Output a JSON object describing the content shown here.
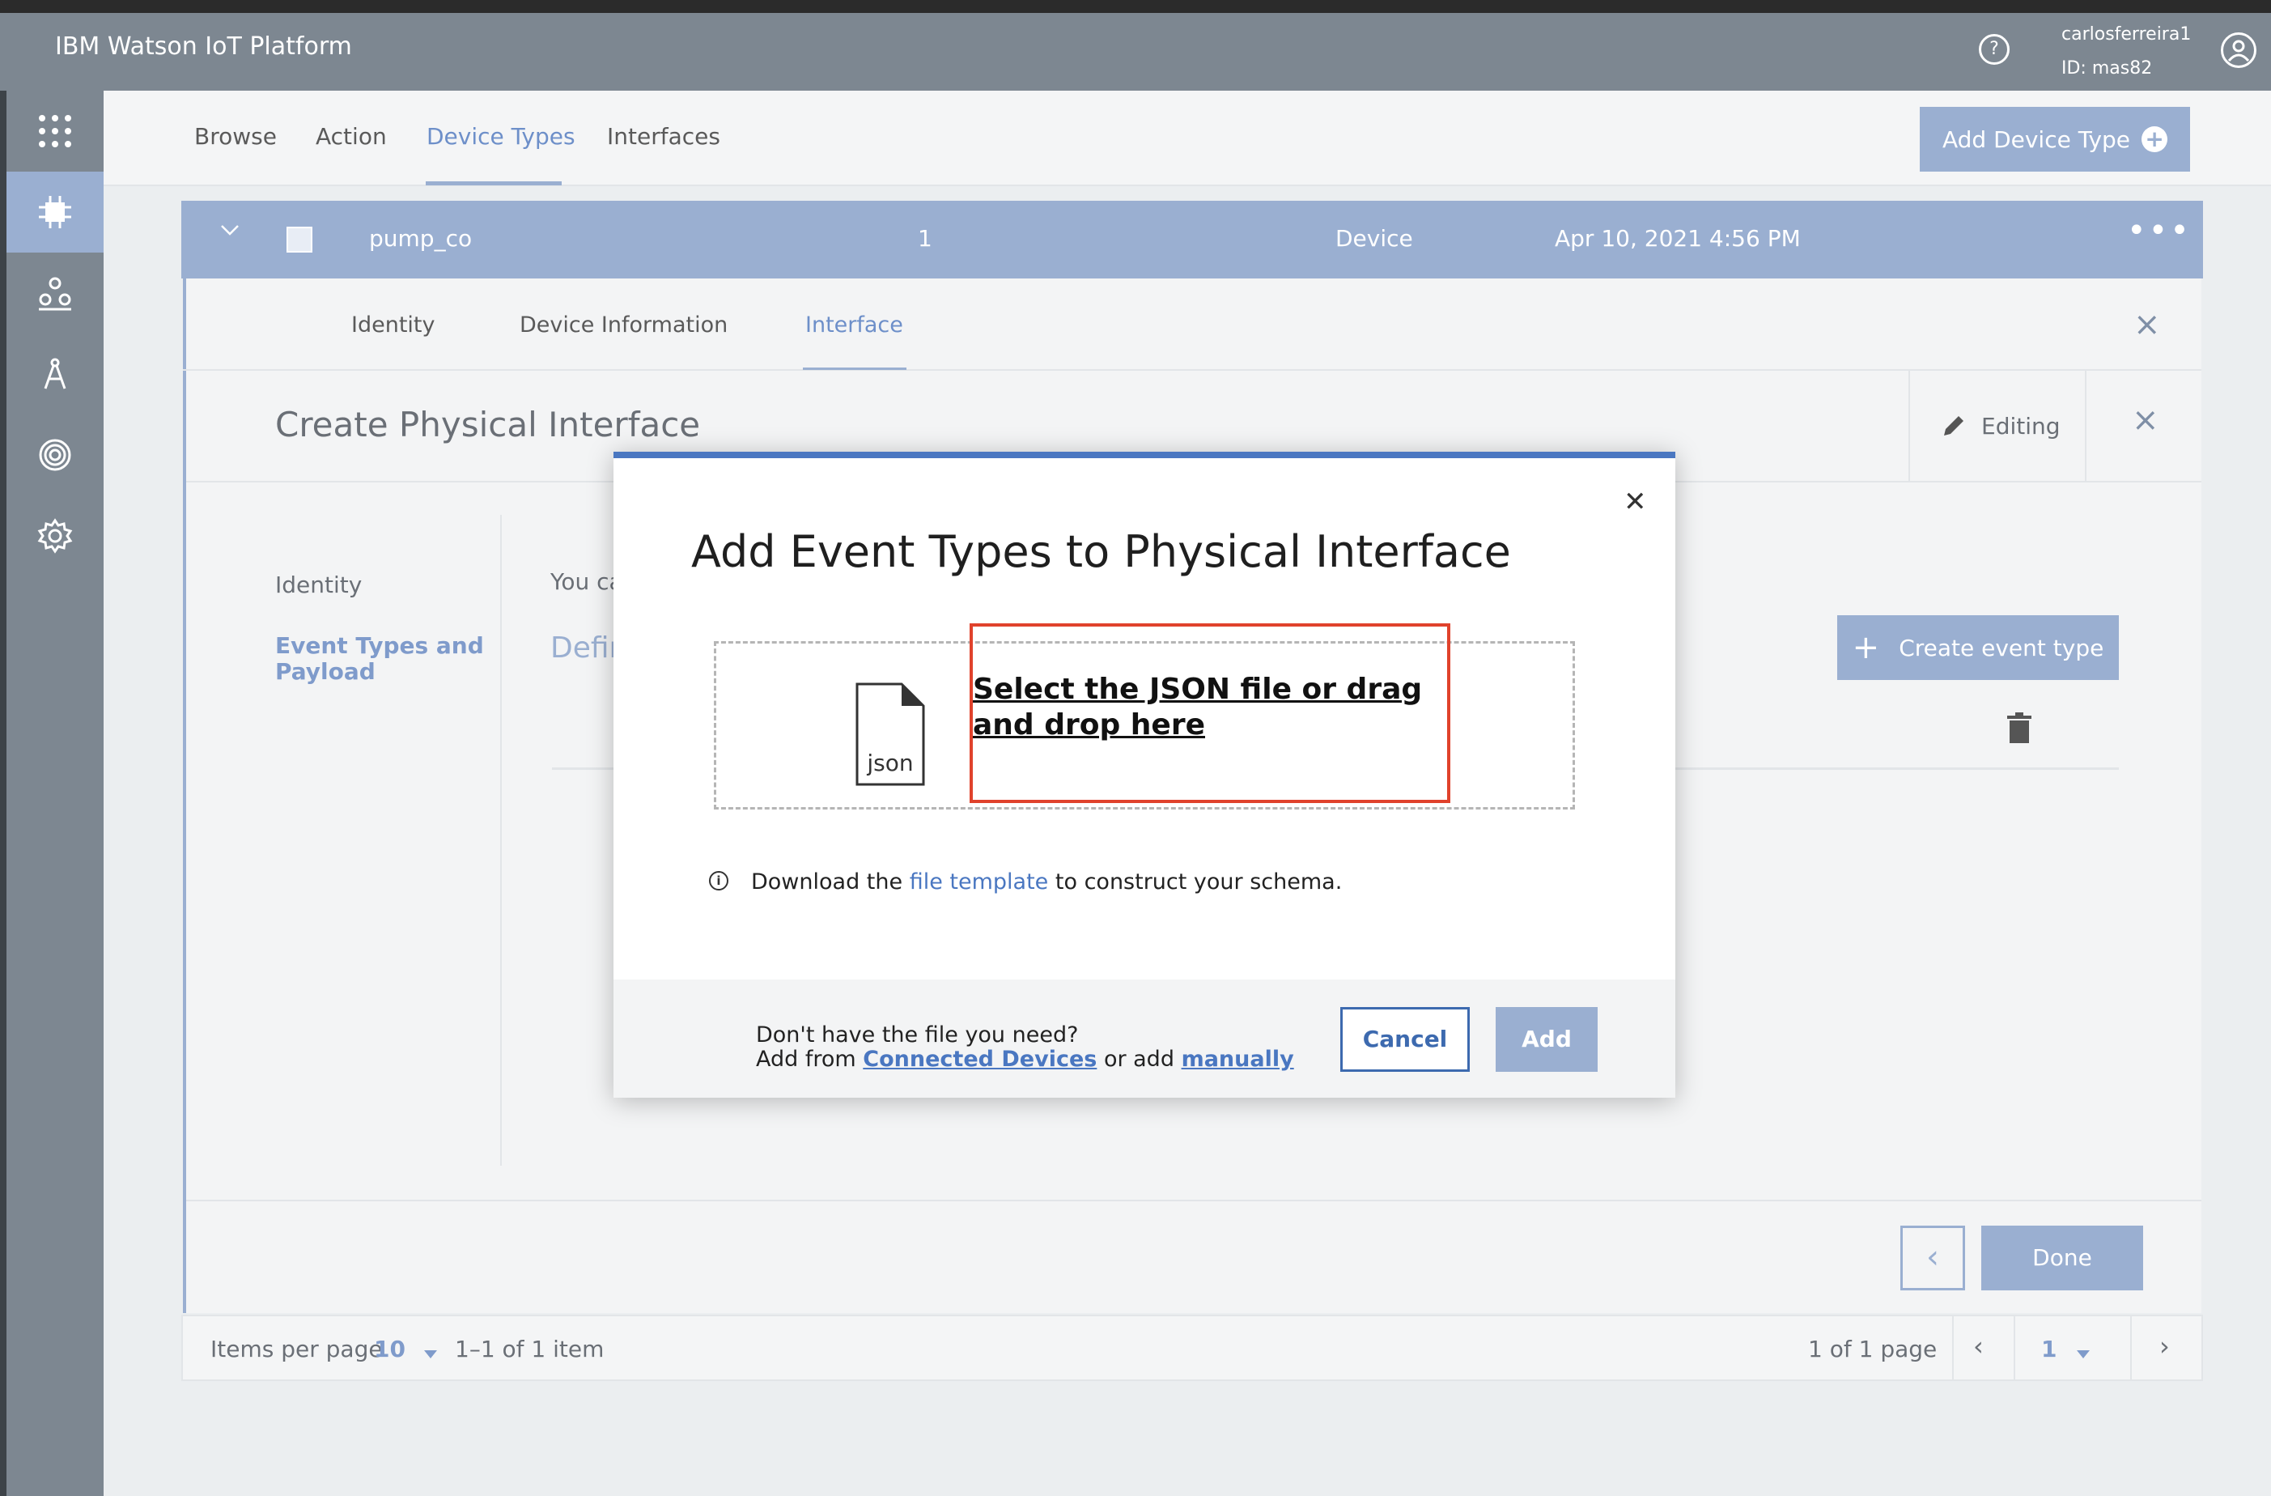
{
  "header": {
    "brand": "IBM Watson IoT Platform",
    "user_name": "carlosferreira1",
    "user_id": "ID: mas82",
    "help_icon": "?"
  },
  "nav": {
    "tabs": [
      "Browse",
      "Action",
      "Device Types",
      "Interfaces"
    ],
    "active_tab": "Device Types",
    "add_device_type": "Add Device Type"
  },
  "device_row": {
    "name": "pump_co",
    "count": "1",
    "class": "Device",
    "date": "Apr 10, 2021 4:56 PM"
  },
  "sub_tabs": [
    "Identity",
    "Device Information",
    "Interface"
  ],
  "active_sub_tab": "Interface",
  "panel": {
    "title": "Create Physical Interface",
    "editing": "Editing",
    "left_nav_identity": "Identity",
    "left_nav_event_types": "Event Types and Payload",
    "content_prefix": "You ca",
    "content_heading": "Defir",
    "create_event_type": "Create event type",
    "done": "Done"
  },
  "pagination": {
    "items_per_page_label": "Items per page",
    "items_per_page_value": "10",
    "range": "1–1 of 1 item",
    "pages": "1 of 1 page",
    "current_page": "1"
  },
  "modal": {
    "title": "Add Event Types to Physical Interface",
    "file_icon_label": "json",
    "drop_text": "Select the JSON file or drag and drop here",
    "download_prefix": "Download the",
    "download_link": "file template",
    "download_suffix": "to construct your schema.",
    "foot_line1": "Don't have the file you need?",
    "foot_add_from": "Add from",
    "foot_link1": "Connected Devices",
    "foot_or_add": "or add",
    "foot_link2": "manually",
    "cancel": "Cancel",
    "add": "Add"
  },
  "colors": {
    "accent": "#9aafd1",
    "link": "#4a77c1",
    "highlight": "#e0422c"
  }
}
